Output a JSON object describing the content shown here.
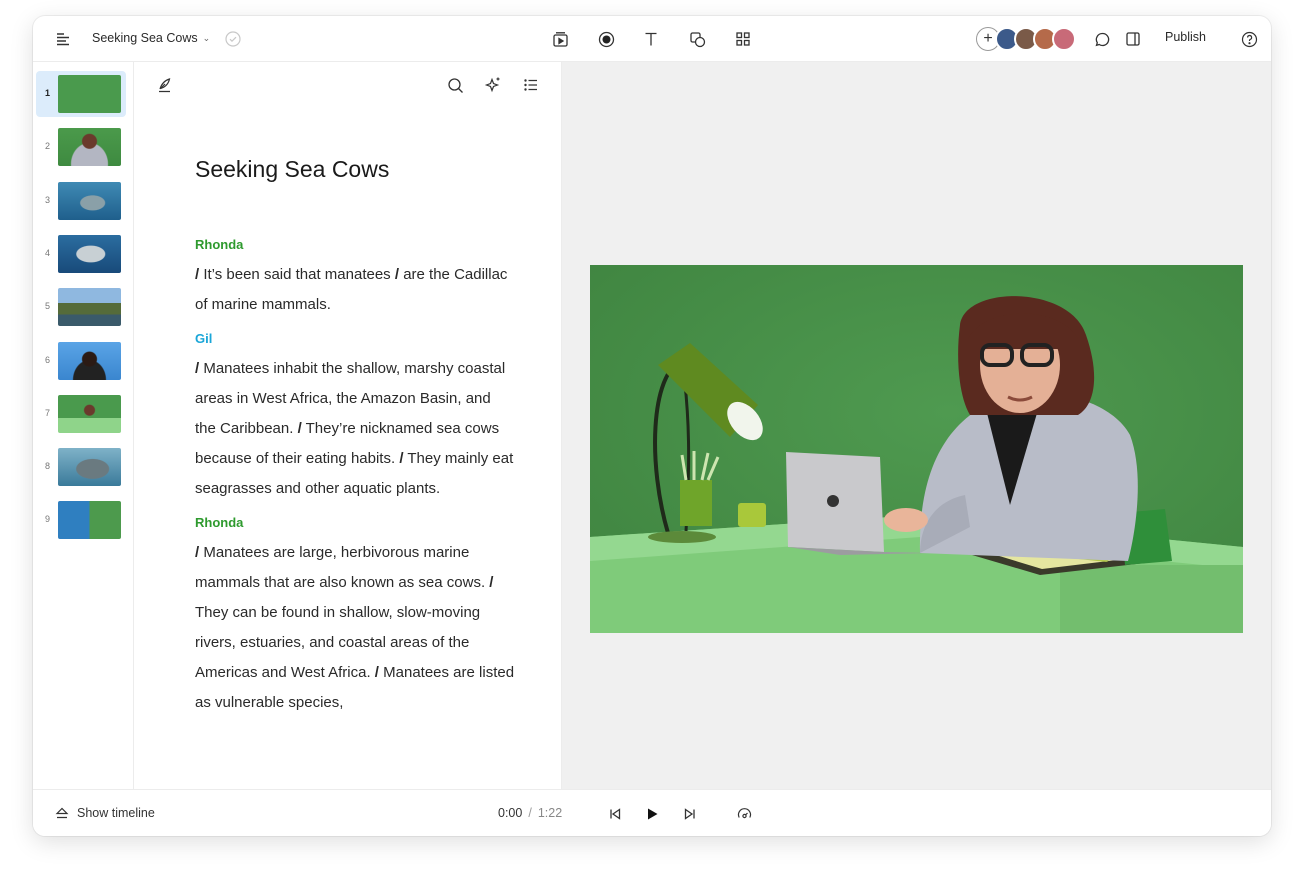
{
  "header": {
    "doc_title": "Seeking Sea Cows",
    "publish_label": "Publish",
    "avatar_colors": [
      "#3c5a8a",
      "#7a5a48",
      "#b56a4a",
      "#c86a78"
    ]
  },
  "slides": [
    {
      "num": "1",
      "active": true
    },
    {
      "num": "2"
    },
    {
      "num": "3"
    },
    {
      "num": "4"
    },
    {
      "num": "5"
    },
    {
      "num": "6"
    },
    {
      "num": "7"
    },
    {
      "num": "8"
    },
    {
      "num": "9"
    }
  ],
  "script": {
    "title": "Seeking Sea Cows",
    "blocks": [
      {
        "speaker": "Rhonda",
        "speaker_color": "#2e9a2e",
        "segments": [
          "It’s been said that manatees",
          "are the Cadillac of marine mammals."
        ]
      },
      {
        "speaker": "Gil",
        "speaker_color": "#1aa6d8",
        "segments": [
          "Manatees inhabit the shallow, marshy coastal areas in West Africa, the Amazon Basin, and the Caribbean.",
          "They’re nicknamed sea cows because of their eating habits.",
          "They mainly eat seagrasses and other aquatic plants."
        ]
      },
      {
        "speaker": "Rhonda",
        "speaker_color": "#2e9a2e",
        "segments": [
          "Manatees are large, herbivorous marine mammals that are also known as sea cows.",
          "They can be found in shallow, slow-moving rivers, estuaries, and coastal areas of the Americas and West Africa.",
          "Manatees are listed as vulnerable species,"
        ]
      }
    ]
  },
  "footer": {
    "show_timeline_label": "Show timeline",
    "current_time": "0:00",
    "separator": "/",
    "duration": "1:22"
  }
}
